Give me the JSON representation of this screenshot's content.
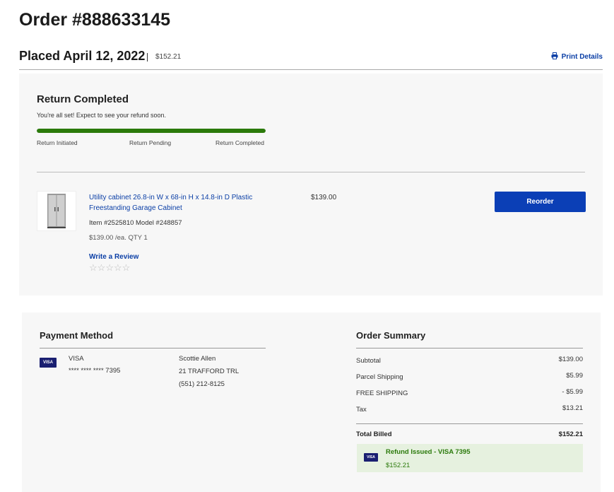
{
  "header": {
    "order_title": "Order #888633145",
    "placed": "Placed April 12, 2022",
    "total": "$152.21",
    "print_label": "Print Details"
  },
  "status": {
    "title": "Return Completed",
    "subtitle": "You're all set! Expect to see your refund soon.",
    "progress_fraction": 1.0,
    "progress_color": "#2b7a0b",
    "steps": [
      "Return Initiated",
      "Return Pending",
      "Return Completed"
    ]
  },
  "item": {
    "name": "Utility cabinet 26.8-in W x 68-in H x 14.8-in D Plastic Freestanding Garage Cabinet",
    "item_model": "Item #2525810 Model #248857",
    "unit_price_qty": "$139.00 /ea. QTY 1",
    "line_price": "$139.00",
    "review_label": "Write a Review",
    "rating": 0,
    "reorder_label": "Reorder"
  },
  "payment": {
    "title": "Payment Method",
    "card_brand": "VISA",
    "card_icon_text": "VISA",
    "card_number": "**** **** **** 7395",
    "name": "Scottie Allen",
    "address": "21 TRAFFORD TRL",
    "phone": "(551) 212-8125"
  },
  "summary": {
    "title": "Order Summary",
    "rows": [
      {
        "label": "Subtotal",
        "value": "$139.00"
      },
      {
        "label": "Parcel Shipping",
        "value": "$5.99"
      },
      {
        "label": "FREE SHIPPING",
        "value": "- $5.99"
      },
      {
        "label": "Tax",
        "value": "$13.21"
      }
    ],
    "total_label": "Total Billed",
    "total_value": "$152.21",
    "refund_title": "Refund Issued - VISA 7395",
    "refund_amount": "$152.21"
  },
  "colors": {
    "accent_blue": "#0b3fb6",
    "link_blue": "#0b3fa6",
    "success_green": "#2b7a0b",
    "refund_bg": "#e6f1df"
  }
}
